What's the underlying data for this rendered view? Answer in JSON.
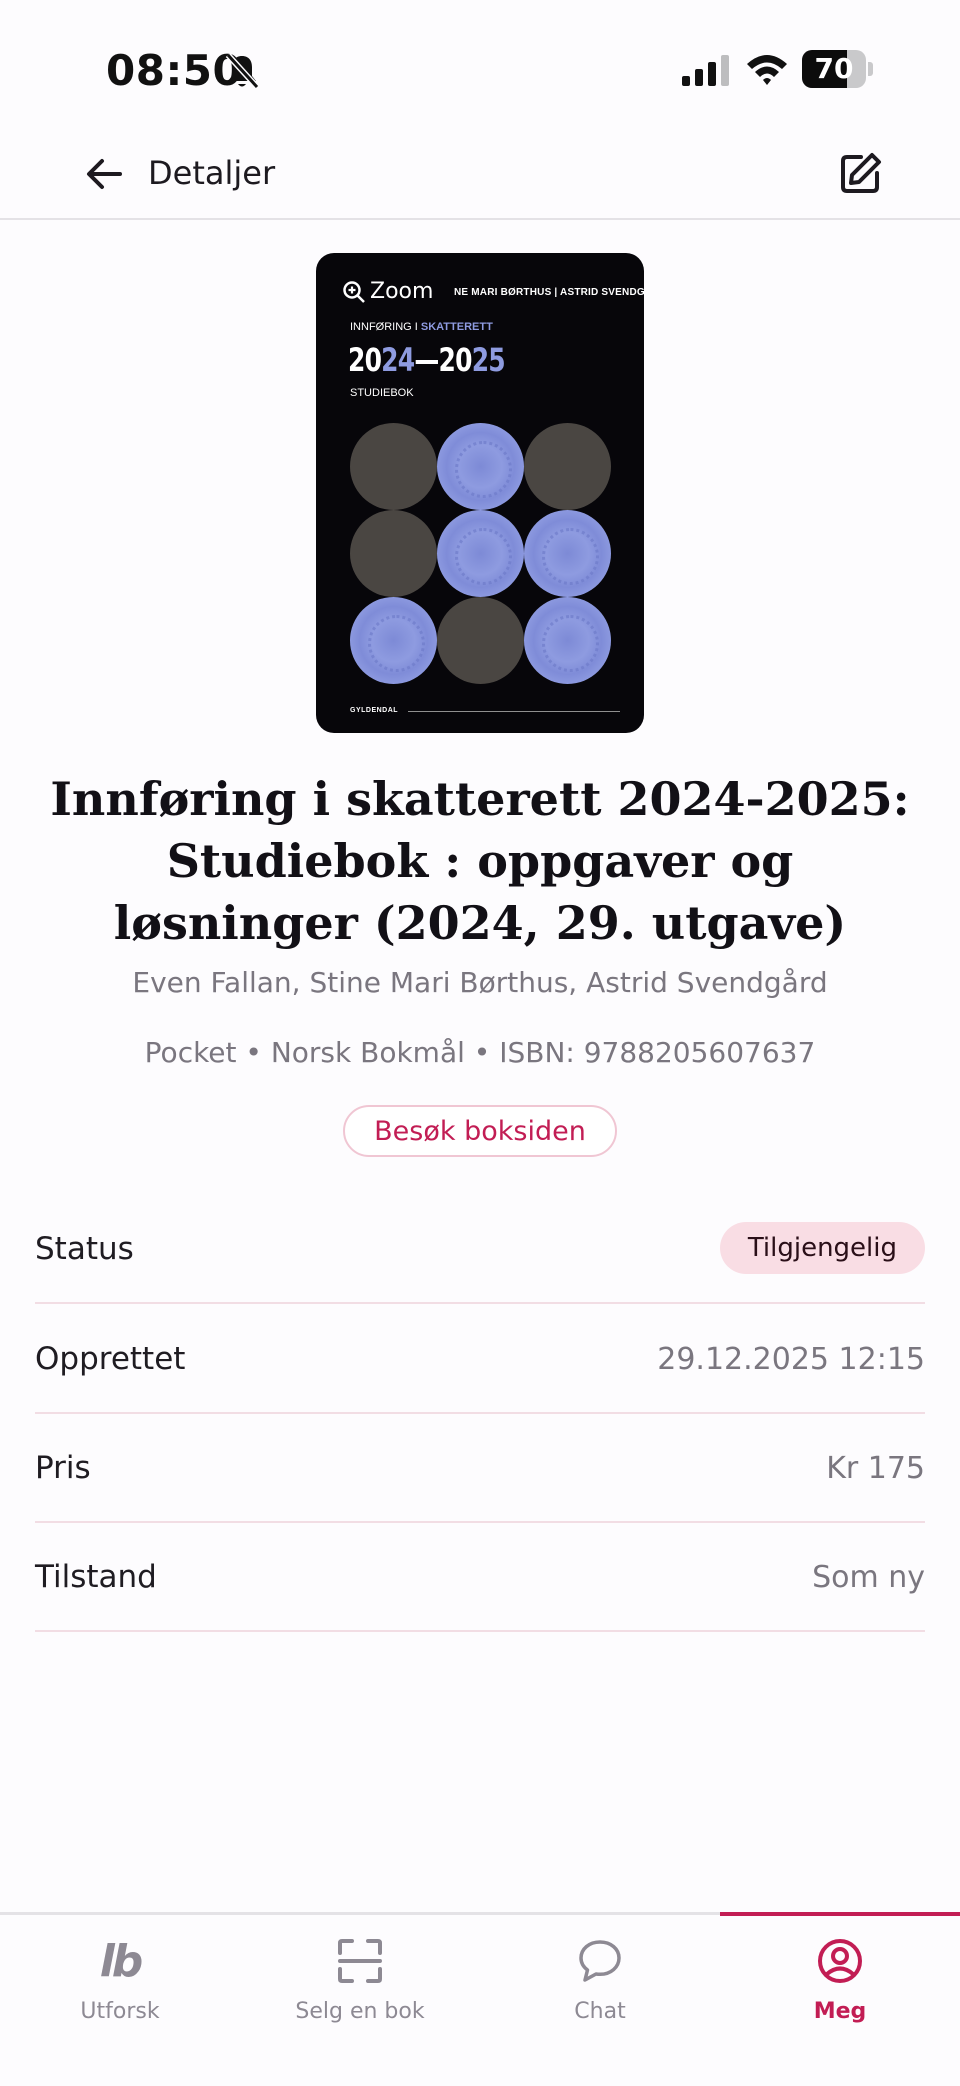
{
  "status_bar": {
    "time": "08:50",
    "battery_level": 70,
    "battery_label": "70"
  },
  "header": {
    "title": "Detaljer"
  },
  "cover": {
    "zoom_label": "Zoom",
    "authors_text": "NE MARI BØRTHUS | ASTRID SVENDGÅRD",
    "pre_title_a": "INNFØRING I ",
    "pre_title_b": "SKATTERETT",
    "year_a": "20",
    "year_b": "24",
    "year_c": "—20",
    "year_d": "25",
    "subtitle": "STUDIEBOK",
    "publisher": "GYLDENDAL"
  },
  "book": {
    "title": "Innføring i skatterett 2024-2025: Studiebok : oppgaver og løsninger (2024, 29. utgave)",
    "authors": "Even Fallan, Stine Mari Børthus, Astrid Svendgård",
    "meta": "Pocket • Norsk Bokmål • ISBN: 9788205607637",
    "visit_label": "Besøk boksiden"
  },
  "details": {
    "status_label": "Status",
    "status_value": "Tilgjengelig",
    "created_label": "Opprettet",
    "created_value": "29.12.2025 12:15",
    "price_label": "Pris",
    "price_value": "Kr 175",
    "condition_label": "Tilstand",
    "condition_value": "Som ny"
  },
  "nav": {
    "explore": "Utforsk",
    "explore_logo": "lb",
    "sell": "Selg en bok",
    "chat": "Chat",
    "me": "Meg"
  },
  "colors": {
    "accent": "#c21d54",
    "status_pill_bg": "#f9dde4",
    "divider": "#f2dde4",
    "muted_text": "#7a767f"
  }
}
